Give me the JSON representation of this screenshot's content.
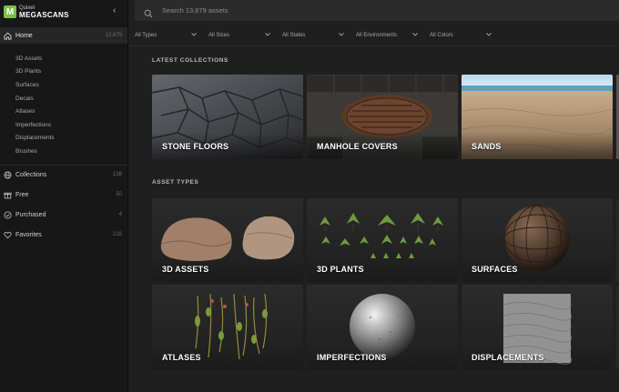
{
  "brand": {
    "line1": "Quixel",
    "line2": "MEGASCANS",
    "logo_letter": "M",
    "accent": "#7bc043"
  },
  "sidebar": {
    "home": {
      "label": "Home",
      "count": "13,679"
    },
    "sub_items": [
      "3D Assets",
      "3D Plants",
      "Surfaces",
      "Decals",
      "Atlases",
      "Imperfections",
      "Displacements",
      "Brushes"
    ],
    "nav": [
      {
        "label": "Collections",
        "count": "138",
        "icon": "globe-icon"
      },
      {
        "label": "Free",
        "count": "50",
        "icon": "gift-icon"
      },
      {
        "label": "Purchased",
        "count": "4",
        "icon": "check-circle-icon"
      },
      {
        "label": "Favorites",
        "count": "218",
        "icon": "heart-icon"
      }
    ]
  },
  "search": {
    "placeholder": "Search 13,679 assets",
    "value": ""
  },
  "filters": [
    "All Types",
    "All Sizes",
    "All States",
    "All Environments",
    "All Colors"
  ],
  "sections": {
    "collections": {
      "title": "LATEST COLLECTIONS",
      "cards": [
        "STONE FLOORS",
        "MANHOLE COVERS",
        "SANDS"
      ]
    },
    "asset_types": {
      "title": "ASSET TYPES",
      "cards": [
        "3D ASSETS",
        "3D PLANTS",
        "SURFACES",
        "ATLASES",
        "IMPERFECTIONS",
        "DISPLACEMENTS"
      ]
    }
  }
}
